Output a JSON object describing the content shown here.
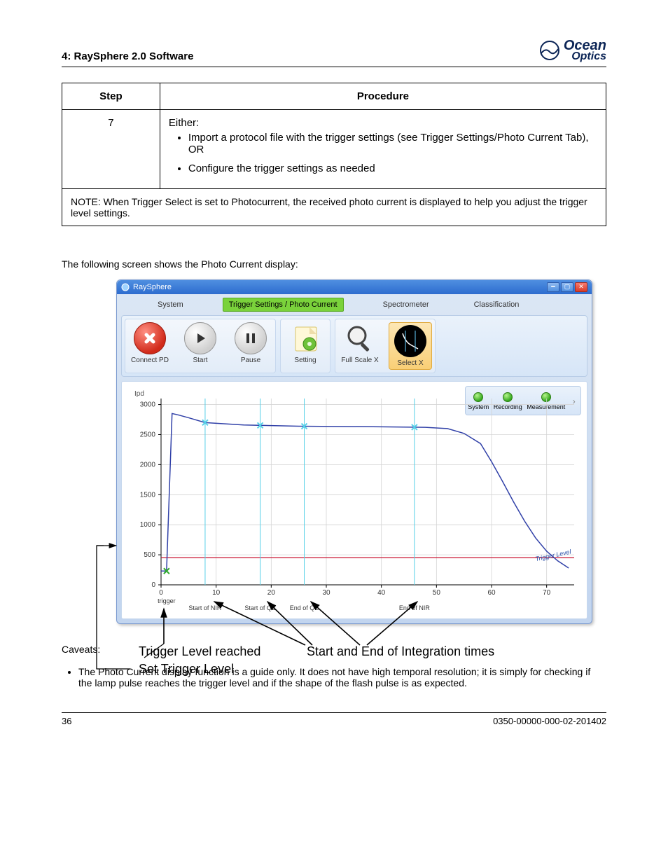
{
  "header_left": "4: RaySphere 2.0 Software",
  "logo": {
    "line1": "Ocean",
    "line2": "Optics"
  },
  "table": {
    "step_hdr": "Step",
    "proc_hdr": "Procedure",
    "step7": "7",
    "step7_lead": "Either:",
    "step7_b1": "Import a protocol file with the trigger settings (see Trigger Settings/Photo Current Tab), OR",
    "step7_b2": "Configure the trigger settings as needed",
    "note": "NOTE: When Trigger Select is set to Photocurrent, the received photo current is displayed to help you adjust the trigger level settings."
  },
  "shot_caption": "The following screen shows the Photo Current display:",
  "app": {
    "title": "RaySphere",
    "tabs": {
      "system": "System",
      "trigger": "Trigger Settings / Photo Current",
      "spectrometer": "Spectrometer",
      "classification": "Classification"
    },
    "tb": {
      "connect": "Connect PD",
      "start": "Start",
      "pause": "Pause",
      "setting": "Setting",
      "fullx": "Full Scale X",
      "selx": "Select X"
    },
    "status": {
      "system": "System",
      "recording": "Recording",
      "measurement": "Measurement"
    },
    "ylab": "Ipd",
    "yticks": [
      "0",
      "500",
      "1000",
      "1500",
      "2000",
      "2500",
      "3000"
    ],
    "xticks": [
      "0",
      "10",
      "20",
      "30",
      "40",
      "50",
      "60",
      "70"
    ],
    "xevent": {
      "trigger": "trigger",
      "snir": "Start of NIR",
      "sqe": "Start of QE",
      "eqe": "End of QE",
      "enir": "End of NIR"
    },
    "tlabel": "Trigger Level"
  },
  "chart_data": {
    "type": "line",
    "xlabel": "",
    "ylabel": "Ipd",
    "xlim": [
      0,
      75
    ],
    "ylim": [
      0,
      3100
    ],
    "trigger_level": 450,
    "events": {
      "trigger_x": 1,
      "start_nir_x": 8,
      "start_qe_x": 18,
      "end_qe_x": 26,
      "end_nir_x": 46
    },
    "series": [
      {
        "name": "photocurrent",
        "x": [
          0,
          1,
          2,
          3,
          5,
          8,
          15,
          25,
          40,
          48,
          52,
          55,
          58,
          60,
          62,
          64,
          66,
          68,
          70,
          72,
          74
        ],
        "y": [
          230,
          230,
          2850,
          2830,
          2780,
          2700,
          2660,
          2640,
          2630,
          2620,
          2600,
          2520,
          2350,
          2050,
          1720,
          1380,
          1060,
          780,
          560,
          400,
          280
        ]
      }
    ]
  },
  "annotations": {
    "a1": "Trigger Level reached",
    "a2": "Start and End of Integration times",
    "a3": "Set Trigger Level"
  },
  "caveats_lead": "Caveats:",
  "caveats": [
    "The Photo Current display function is a guide only. It does not have high temporal resolution; it is simply for checking if the lamp pulse reaches the trigger level and if the shape of the flash pulse is as expected."
  ],
  "footer": {
    "left": "36",
    "right": "0350-00000-000-02-201402"
  }
}
